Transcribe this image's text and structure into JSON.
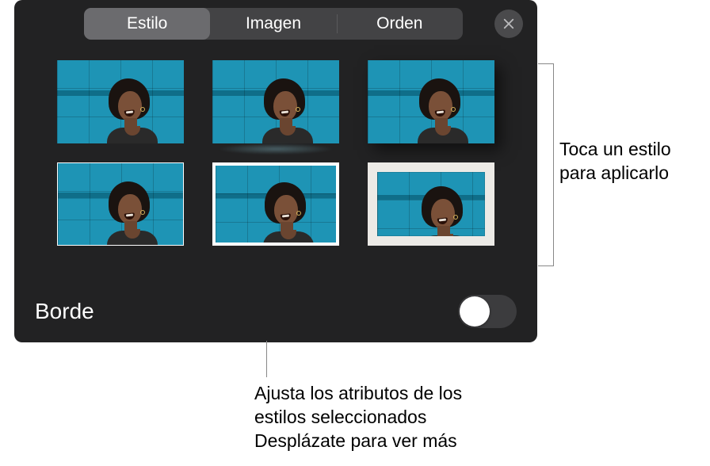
{
  "tabs": {
    "style": "Estilo",
    "image": "Imagen",
    "order": "Orden"
  },
  "border": {
    "label": "Borde"
  },
  "callouts": {
    "right": "Toca un estilo para aplicarlo",
    "bottom": "Ajusta los atributos de los estilos seleccionados Desplázate para ver más"
  }
}
